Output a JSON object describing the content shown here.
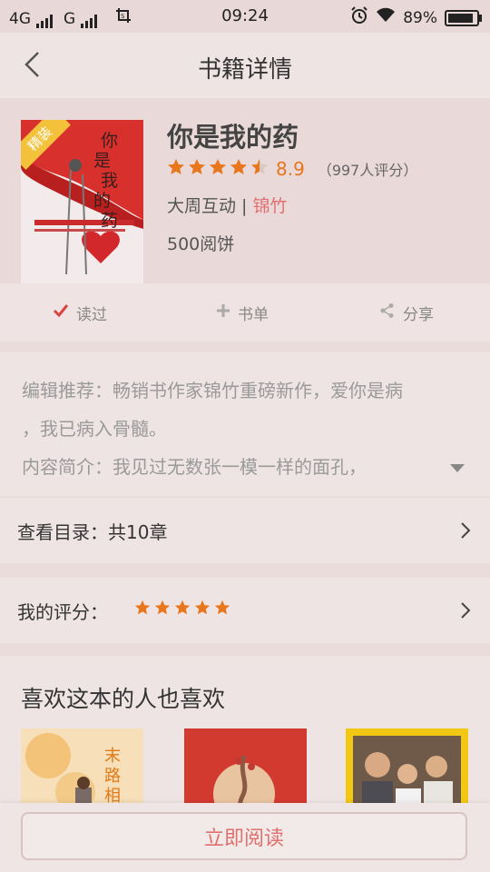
{
  "status_bar": {
    "network1": "4G",
    "network2": "G",
    "time": "09:24",
    "battery": "89%",
    "battery_level": 0.89,
    "icons": [
      "signal-icon",
      "screenshot-icon",
      "alarm-icon",
      "wifi-icon",
      "battery-icon"
    ]
  },
  "header": {
    "title": "书籍详情",
    "back_icon": "back-arrow-icon"
  },
  "book": {
    "title": "你是我的药",
    "rating_score": "8.9",
    "rating_count": "（997人评分）",
    "stars": 4.5,
    "publisher": "大周互动",
    "separator": " | ",
    "author": "锦竹",
    "reads": "500阅饼",
    "cover": {
      "badge": "精装",
      "title_chars": [
        "你",
        "是",
        "我",
        "的",
        "药"
      ]
    }
  },
  "actions": [
    {
      "label": "读过",
      "icon": "check-icon"
    },
    {
      "label": "书单",
      "icon": "plus-icon"
    },
    {
      "label": "分享",
      "icon": "share-icon"
    }
  ],
  "description": {
    "line1": "编辑推荐：畅销书作家锦竹重磅新作，爱你是病",
    "line2": "，我已病入骨髓。",
    "line3": "内容简介：我见过无数张一模一样的面孔，"
  },
  "toc": {
    "label": "查看目录：共10章"
  },
  "my_rating": {
    "label": "我的评分：",
    "stars": 5
  },
  "recommendations": {
    "title": "喜欢这本的人也喜欢",
    "books": [
      {
        "cover_text": "末路相"
      },
      {
        "cover_text": ""
      },
      {
        "cover_text": ""
      }
    ]
  },
  "bottom": {
    "read_button": "立即阅读"
  },
  "colors": {
    "accent": "#e8761d",
    "author_red": "#e07070",
    "button_text": "#e0706c",
    "check_red": "#d9453f"
  }
}
